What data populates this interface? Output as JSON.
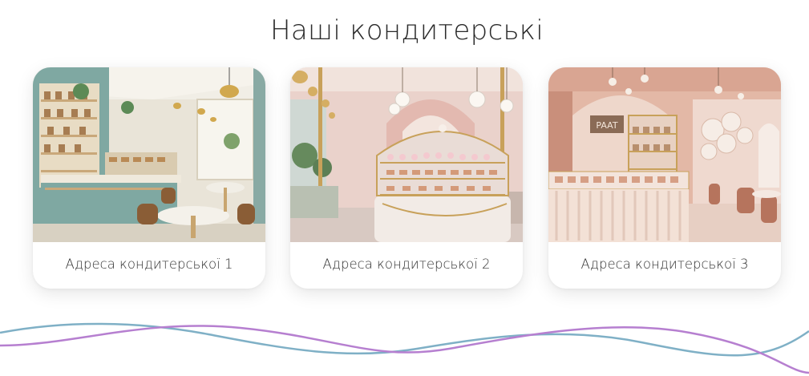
{
  "section": {
    "title": "Наші кондитерські"
  },
  "cards": [
    {
      "caption": "Адреса кондитерської 1"
    },
    {
      "caption": "Адреса кондитерської 2"
    },
    {
      "caption": "Адреса кондитерської 3"
    }
  ],
  "colors": {
    "wave_purple": "#b67fd0",
    "wave_teal": "#7fb0c6",
    "card_shadow": "rgba(0,0,0,0.10)"
  }
}
